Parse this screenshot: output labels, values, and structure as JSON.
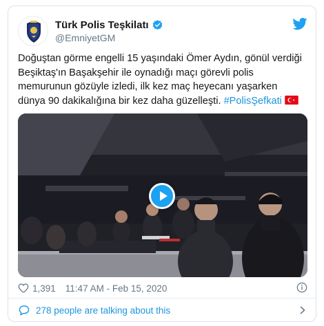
{
  "account": {
    "display_name": "Türk Polis Teşkilatı",
    "handle": "@EmniyetGM",
    "avatar_icon": "police-badge-icon",
    "verified_icon": "verified-badge-icon"
  },
  "brand_icon": "twitter-bird-icon",
  "tweet": {
    "text": "Doğuştan görme engelli 15 yaşındaki Ömer Aydın, gönül verdiği Beşiktaş'ın Başakşehir ile oynadığı maçı görevli polis memurunun gözüyle izledi, ilk kez maç heyecanı yaşarken dünya 90 dakikalığına bir kez daha güzelleşti.",
    "hashtag": "#PolisŞefkati",
    "flag_icon": "turkey-flag-icon"
  },
  "media": {
    "type": "video",
    "play_icon": "play-icon"
  },
  "meta": {
    "like_count": "1,391",
    "timestamp": "11:47 AM - Feb 15, 2020",
    "heart_icon": "heart-icon",
    "info_icon": "info-icon"
  },
  "conversation": {
    "label": "278 people are talking about this",
    "bubble_icon": "speech-bubble-icon",
    "chevron_icon": "chevron-right-icon"
  },
  "colors": {
    "link": "#1b95e0",
    "secondary_text": "#657786",
    "play_button": "#1da1f2",
    "flag_red": "#e30a17"
  }
}
